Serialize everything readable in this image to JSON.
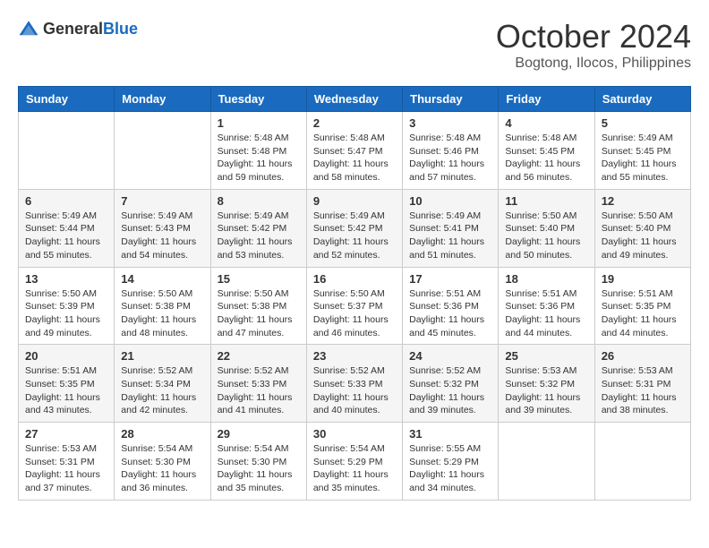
{
  "logo": {
    "general": "General",
    "blue": "Blue"
  },
  "title": "October 2024",
  "location": "Bogtong, Ilocos, Philippines",
  "days_of_week": [
    "Sunday",
    "Monday",
    "Tuesday",
    "Wednesday",
    "Thursday",
    "Friday",
    "Saturday"
  ],
  "weeks": [
    [
      {
        "day": "",
        "info": ""
      },
      {
        "day": "",
        "info": ""
      },
      {
        "day": "1",
        "info": "Sunrise: 5:48 AM\nSunset: 5:48 PM\nDaylight: 11 hours and 59 minutes."
      },
      {
        "day": "2",
        "info": "Sunrise: 5:48 AM\nSunset: 5:47 PM\nDaylight: 11 hours and 58 minutes."
      },
      {
        "day": "3",
        "info": "Sunrise: 5:48 AM\nSunset: 5:46 PM\nDaylight: 11 hours and 57 minutes."
      },
      {
        "day": "4",
        "info": "Sunrise: 5:48 AM\nSunset: 5:45 PM\nDaylight: 11 hours and 56 minutes."
      },
      {
        "day": "5",
        "info": "Sunrise: 5:49 AM\nSunset: 5:45 PM\nDaylight: 11 hours and 55 minutes."
      }
    ],
    [
      {
        "day": "6",
        "info": "Sunrise: 5:49 AM\nSunset: 5:44 PM\nDaylight: 11 hours and 55 minutes."
      },
      {
        "day": "7",
        "info": "Sunrise: 5:49 AM\nSunset: 5:43 PM\nDaylight: 11 hours and 54 minutes."
      },
      {
        "day": "8",
        "info": "Sunrise: 5:49 AM\nSunset: 5:42 PM\nDaylight: 11 hours and 53 minutes."
      },
      {
        "day": "9",
        "info": "Sunrise: 5:49 AM\nSunset: 5:42 PM\nDaylight: 11 hours and 52 minutes."
      },
      {
        "day": "10",
        "info": "Sunrise: 5:49 AM\nSunset: 5:41 PM\nDaylight: 11 hours and 51 minutes."
      },
      {
        "day": "11",
        "info": "Sunrise: 5:50 AM\nSunset: 5:40 PM\nDaylight: 11 hours and 50 minutes."
      },
      {
        "day": "12",
        "info": "Sunrise: 5:50 AM\nSunset: 5:40 PM\nDaylight: 11 hours and 49 minutes."
      }
    ],
    [
      {
        "day": "13",
        "info": "Sunrise: 5:50 AM\nSunset: 5:39 PM\nDaylight: 11 hours and 49 minutes."
      },
      {
        "day": "14",
        "info": "Sunrise: 5:50 AM\nSunset: 5:38 PM\nDaylight: 11 hours and 48 minutes."
      },
      {
        "day": "15",
        "info": "Sunrise: 5:50 AM\nSunset: 5:38 PM\nDaylight: 11 hours and 47 minutes."
      },
      {
        "day": "16",
        "info": "Sunrise: 5:50 AM\nSunset: 5:37 PM\nDaylight: 11 hours and 46 minutes."
      },
      {
        "day": "17",
        "info": "Sunrise: 5:51 AM\nSunset: 5:36 PM\nDaylight: 11 hours and 45 minutes."
      },
      {
        "day": "18",
        "info": "Sunrise: 5:51 AM\nSunset: 5:36 PM\nDaylight: 11 hours and 44 minutes."
      },
      {
        "day": "19",
        "info": "Sunrise: 5:51 AM\nSunset: 5:35 PM\nDaylight: 11 hours and 44 minutes."
      }
    ],
    [
      {
        "day": "20",
        "info": "Sunrise: 5:51 AM\nSunset: 5:35 PM\nDaylight: 11 hours and 43 minutes."
      },
      {
        "day": "21",
        "info": "Sunrise: 5:52 AM\nSunset: 5:34 PM\nDaylight: 11 hours and 42 minutes."
      },
      {
        "day": "22",
        "info": "Sunrise: 5:52 AM\nSunset: 5:33 PM\nDaylight: 11 hours and 41 minutes."
      },
      {
        "day": "23",
        "info": "Sunrise: 5:52 AM\nSunset: 5:33 PM\nDaylight: 11 hours and 40 minutes."
      },
      {
        "day": "24",
        "info": "Sunrise: 5:52 AM\nSunset: 5:32 PM\nDaylight: 11 hours and 39 minutes."
      },
      {
        "day": "25",
        "info": "Sunrise: 5:53 AM\nSunset: 5:32 PM\nDaylight: 11 hours and 39 minutes."
      },
      {
        "day": "26",
        "info": "Sunrise: 5:53 AM\nSunset: 5:31 PM\nDaylight: 11 hours and 38 minutes."
      }
    ],
    [
      {
        "day": "27",
        "info": "Sunrise: 5:53 AM\nSunset: 5:31 PM\nDaylight: 11 hours and 37 minutes."
      },
      {
        "day": "28",
        "info": "Sunrise: 5:54 AM\nSunset: 5:30 PM\nDaylight: 11 hours and 36 minutes."
      },
      {
        "day": "29",
        "info": "Sunrise: 5:54 AM\nSunset: 5:30 PM\nDaylight: 11 hours and 35 minutes."
      },
      {
        "day": "30",
        "info": "Sunrise: 5:54 AM\nSunset: 5:29 PM\nDaylight: 11 hours and 35 minutes."
      },
      {
        "day": "31",
        "info": "Sunrise: 5:55 AM\nSunset: 5:29 PM\nDaylight: 11 hours and 34 minutes."
      },
      {
        "day": "",
        "info": ""
      },
      {
        "day": "",
        "info": ""
      }
    ]
  ]
}
